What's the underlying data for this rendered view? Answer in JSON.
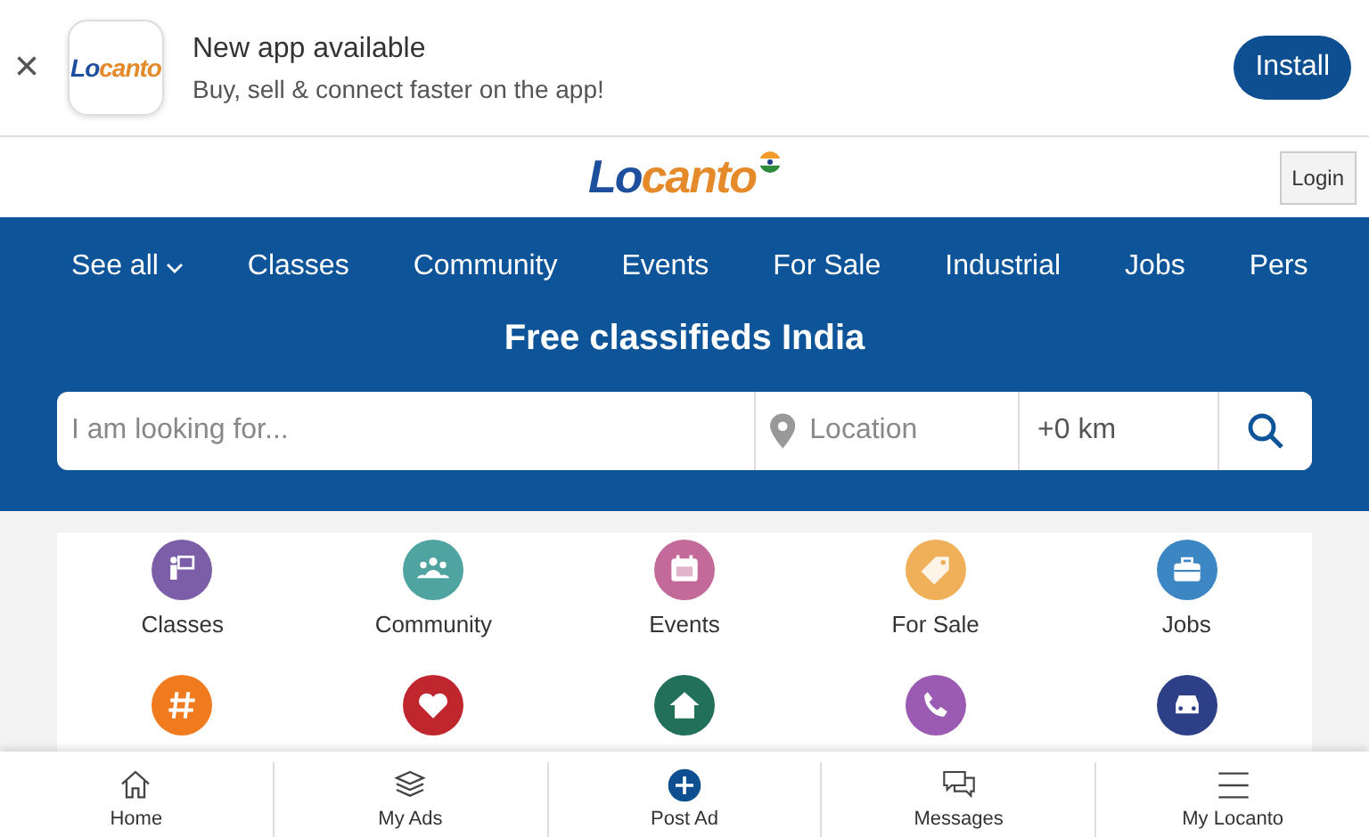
{
  "app_banner": {
    "logo": "Locanto",
    "title": "New app available",
    "subtitle": "Buy, sell & connect faster on the app!",
    "close": "×",
    "install": "Install"
  },
  "header": {
    "logo": "Locanto",
    "login": "Login"
  },
  "nav": {
    "items": [
      {
        "label": "See all",
        "dropdown": true
      },
      {
        "label": "Classes",
        "dropdown": false
      },
      {
        "label": "Community",
        "dropdown": false
      },
      {
        "label": "Events",
        "dropdown": false
      },
      {
        "label": "For Sale",
        "dropdown": false
      },
      {
        "label": "Industrial",
        "dropdown": false
      },
      {
        "label": "Jobs",
        "dropdown": false
      },
      {
        "label": "Pers",
        "dropdown": false
      }
    ]
  },
  "hero": {
    "title": "Free classifieds India"
  },
  "search": {
    "placeholder": "I am looking for...",
    "location_placeholder": "Location",
    "radius": "+0 km"
  },
  "categories": [
    {
      "label": "Classes",
      "color": "#7b5ea7"
    },
    {
      "label": "Community",
      "color": "#4fa3a0"
    },
    {
      "label": "Events",
      "color": "#c46a9a"
    },
    {
      "label": "For Sale",
      "color": "#f0b05a"
    },
    {
      "label": "Jobs",
      "color": "#3c86c4"
    },
    {
      "color": "#f07a1e"
    },
    {
      "color": "#c0262d"
    },
    {
      "color": "#23705a"
    },
    {
      "color": "#9b5bb3"
    },
    {
      "color": "#2d3f86"
    }
  ],
  "bottom_nav": [
    {
      "label": "Home"
    },
    {
      "label": "My Ads"
    },
    {
      "label": "Post Ad"
    },
    {
      "label": "Messages"
    },
    {
      "label": "My Locanto"
    }
  ]
}
